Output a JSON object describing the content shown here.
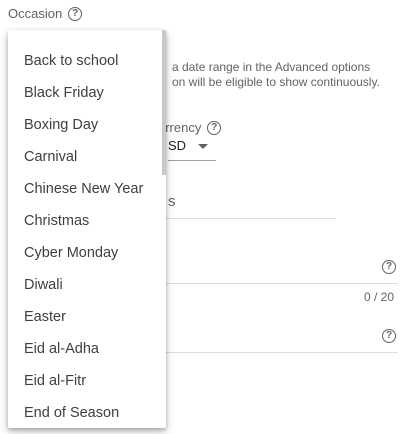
{
  "occasion": {
    "label": "Occasion"
  },
  "hint": {
    "line1": "a date range in the Advanced options",
    "line2": "on will be eligible to show continuously."
  },
  "currency": {
    "label": "urrency",
    "value": "SD"
  },
  "promo_field": {
    "text": "s"
  },
  "counter": "0 / 20",
  "dropdown": {
    "items": [
      "Back to school",
      "Black Friday",
      "Boxing Day",
      "Carnival",
      "Chinese New Year",
      "Christmas",
      "Cyber Monday",
      "Diwali",
      "Easter",
      "Eid al-Adha",
      "Eid al-Fitr",
      "End of Season"
    ]
  }
}
